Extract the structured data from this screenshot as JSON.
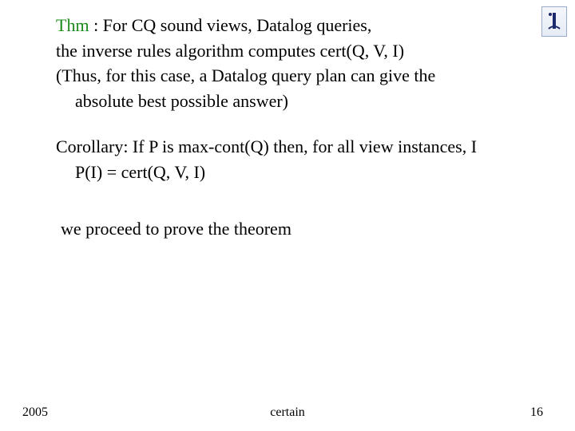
{
  "header": {
    "logo_alt": "institution-logo"
  },
  "theorem": {
    "lead": "Thm",
    "lead_sep": " : ",
    "line1_after": "For CQ sound views, Datalog queries,",
    "line2": "the inverse rules algorithm  computes cert(Q, V, I)",
    "line3": "(Thus, for this case, a Datalog query plan  can give the",
    "line4": "absolute best possible answer)"
  },
  "corollary": {
    "line1": "Corollary:  If P is max-cont(Q) then, for all  view instances, I",
    "line2": "P(I) = cert(Q, V, I)"
  },
  "proceed": {
    "text": "we proceed to prove the theorem"
  },
  "footer": {
    "year": "2005",
    "center": "certain",
    "page": "16"
  }
}
